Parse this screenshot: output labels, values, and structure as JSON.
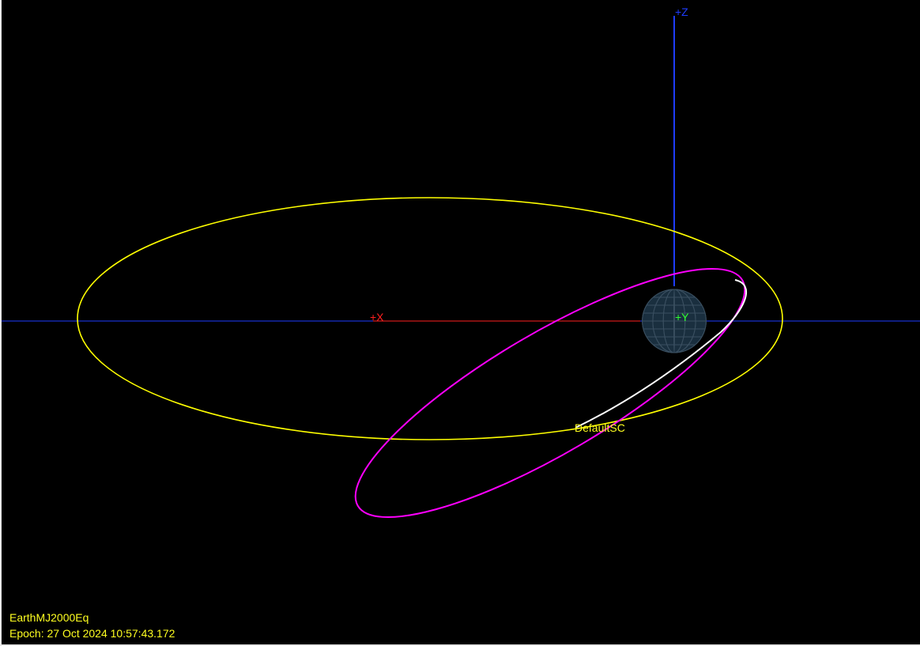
{
  "view": {
    "background_color": "#000000"
  },
  "axes": {
    "x": {
      "label": "+X",
      "color": "#ff2020"
    },
    "y": {
      "label": "+Y",
      "color": "#30ff30"
    },
    "z": {
      "label": "+Z",
      "color": "#1e3cff"
    }
  },
  "earth": {
    "body_color": "#1a2f3f",
    "grid_color": "#3a4f60"
  },
  "orbits": {
    "equatorial": {
      "color": "#ffff00"
    },
    "spacecraft_track": {
      "color": "#ff00ff"
    },
    "spacecraft_recent": {
      "color": "#ffffff"
    }
  },
  "spacecraft": {
    "name": "DefaultSC",
    "label_color": "#ffff20"
  },
  "info": {
    "coordinate_system": "EarthMJ2000Eq",
    "epoch": "Epoch: 27 Oct 2024 10:57:43.172",
    "text_color": "#ffff20"
  }
}
